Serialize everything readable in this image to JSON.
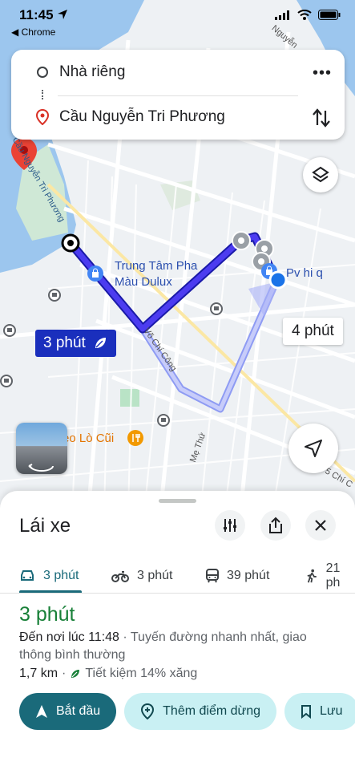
{
  "status_bar": {
    "time": "11:45",
    "back_app": "◀ Chrome"
  },
  "search": {
    "origin": "Nhà riêng",
    "destination": "Cầu Nguyễn Tri Phương"
  },
  "map": {
    "poi_1_line1": "Trung Tâm Pha",
    "poi_1_line2": "Màu Dulux",
    "poi_2": "Pv hi q",
    "poi_3": "eo Lò Cũi",
    "street_1": "Võ Chí Công",
    "street_2": "Mẹ Thứ",
    "street_3": "Cầu Nguyễn Tri Phương",
    "street_4": "Nguyễn",
    "street_5": "5 Chí C",
    "route_primary_time": "3 phút",
    "route_alt_time": "4 phút",
    "colors": {
      "route": "#3a2fd6",
      "route_alt": "#6f7cf0",
      "water": "#9cc6ee",
      "park": "#cfeadb"
    }
  },
  "sheet": {
    "title": "Lái xe",
    "modes": [
      {
        "icon": "car-icon",
        "label": "3 phút"
      },
      {
        "icon": "motorbike-icon",
        "label": "3 phút"
      },
      {
        "icon": "transit-icon",
        "label": "39 phút"
      },
      {
        "icon": "walk-icon",
        "label": "21 ph"
      }
    ],
    "duration": "3 phút",
    "arrival": "Đến nơi lúc 11:48",
    "description": " · Tuyến đường nhanh nhất, giao thông bình thường",
    "distance": "1,7 km",
    "savings": "Tiết kiệm 14% xăng",
    "separator": "·",
    "start_label": "Bắt đầu",
    "add_stop_label": "Thêm điểm dừng",
    "save_label": "Lưu"
  }
}
